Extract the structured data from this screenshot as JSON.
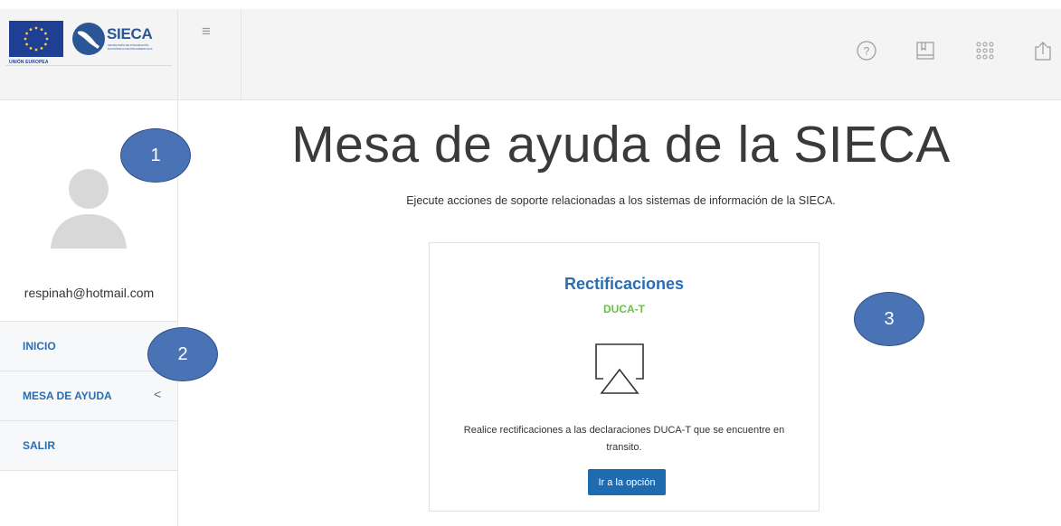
{
  "header": {
    "eu_label": "UNIÓN EUROPEA",
    "brand_name": "SIECA",
    "brand_subtitle": "SECRETARÍA DE INTEGRACIÓN ECONÓMICA CENTROAMERICANA",
    "menu_icon": "hamburger-icon",
    "actions": [
      {
        "icon": "help-icon"
      },
      {
        "icon": "book-icon"
      },
      {
        "icon": "apps-grid-icon"
      },
      {
        "icon": "upload-icon"
      }
    ]
  },
  "sidebar": {
    "avatar_icon": "user-avatar-icon",
    "email": "respinah@hotmail.com",
    "items": [
      {
        "label": "INICIO"
      },
      {
        "label": "MESA DE AYUDA",
        "chevron": "<"
      },
      {
        "label": "SALIR"
      }
    ]
  },
  "main": {
    "title": "Mesa de ayuda de la SIECA",
    "subtitle": "Ejecute acciones de soporte relacionadas a los sistemas de información de la SIECA.",
    "card": {
      "title": "Rectificaciones",
      "subtitle": "DUCA-T",
      "icon": "airplay-icon",
      "description": "Realice rectificaciones a las declaraciones DUCA-T que se encuentre en transito.",
      "button_label": "Ir a la opción"
    }
  },
  "callouts": [
    "1",
    "2",
    "3"
  ],
  "colors": {
    "accent": "#2a6db3",
    "green": "#6cc04a",
    "button": "#1f6bb0",
    "callout": "#4a73b5"
  }
}
